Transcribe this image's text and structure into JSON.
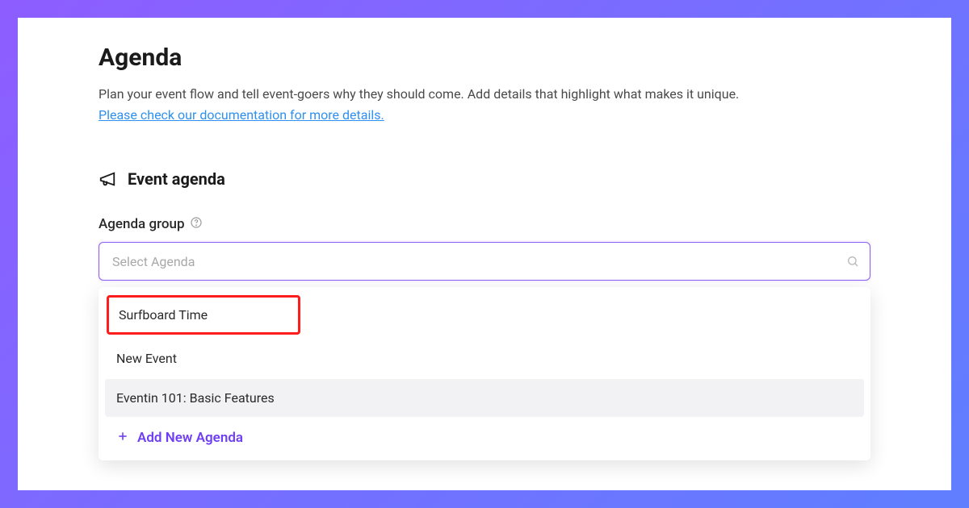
{
  "header": {
    "title": "Agenda",
    "description": "Plan your event flow and tell event-goers why they should come. Add details that highlight what makes it unique.",
    "doc_link_text": "Please check our documentation for more details."
  },
  "section": {
    "title": "Event agenda"
  },
  "field": {
    "label": "Agenda group",
    "placeholder": "Select Agenda"
  },
  "dropdown": {
    "options": [
      "Surfboard Time",
      "New Event",
      "Eventin 101: Basic Features"
    ],
    "add_label": "Add New Agenda"
  }
}
